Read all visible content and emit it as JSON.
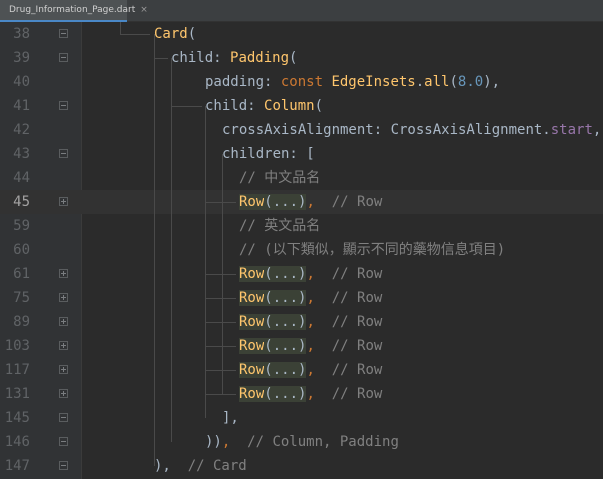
{
  "tab": {
    "filename": "Drug_Information_Page.dart",
    "close": "×"
  },
  "lines": [
    {
      "num": "38",
      "fold": "minus",
      "indent": 154,
      "tokens": [
        [
          "cls",
          "Card"
        ],
        [
          "plain",
          "("
        ]
      ]
    },
    {
      "num": "39",
      "fold": "minus",
      "indent": 171,
      "tokens": [
        [
          "plain",
          "child: "
        ],
        [
          "cls",
          "Padding"
        ],
        [
          "plain",
          "("
        ]
      ]
    },
    {
      "num": "40",
      "fold": "none",
      "indent": 205,
      "tokens": [
        [
          "plain",
          "padding: "
        ],
        [
          "kw",
          "const "
        ],
        [
          "cls",
          "EdgeInsets"
        ],
        [
          "plain",
          "."
        ],
        [
          "fn",
          "all"
        ],
        [
          "plain",
          "("
        ],
        [
          "num",
          "8.0"
        ],
        [
          "plain",
          "),"
        ]
      ]
    },
    {
      "num": "41",
      "fold": "minus",
      "indent": 205,
      "tokens": [
        [
          "plain",
          "child: "
        ],
        [
          "cls",
          "Column"
        ],
        [
          "plain",
          "("
        ]
      ]
    },
    {
      "num": "42",
      "fold": "none",
      "indent": 222,
      "tokens": [
        [
          "plain",
          "crossAxisAlignment: "
        ],
        [
          "plain",
          "CrossAxisAlignment."
        ],
        [
          "prop",
          "start"
        ],
        [
          "plain",
          ","
        ]
      ]
    },
    {
      "num": "43",
      "fold": "minus",
      "indent": 222,
      "tokens": [
        [
          "plain",
          "children: ["
        ]
      ]
    },
    {
      "num": "44",
      "fold": "none",
      "indent": 239,
      "tokens": [
        [
          "cmt",
          "// 中文品名"
        ]
      ]
    },
    {
      "num": "45",
      "fold": "plus",
      "indent": 239,
      "current": true,
      "tokens": [
        [
          "rowname",
          "Row"
        ],
        [
          "folded",
          "(...)"
        ],
        [
          "kw",
          ","
        ],
        [
          "cmt",
          "  // Row"
        ]
      ]
    },
    {
      "num": "59",
      "fold": "none",
      "indent": 239,
      "tokens": [
        [
          "cmt",
          "// 英文品名"
        ]
      ]
    },
    {
      "num": "60",
      "fold": "none",
      "indent": 239,
      "tokens": [
        [
          "cmt",
          "// (以下類似，顯示不同的藥物信息項目)"
        ]
      ]
    },
    {
      "num": "61",
      "fold": "plus",
      "indent": 239,
      "tokens": [
        [
          "rowname",
          "Row"
        ],
        [
          "folded",
          "(...)"
        ],
        [
          "kw",
          ","
        ],
        [
          "cmt",
          "  // Row"
        ]
      ]
    },
    {
      "num": "75",
      "fold": "plus",
      "indent": 239,
      "tokens": [
        [
          "rowname",
          "Row"
        ],
        [
          "folded",
          "(...)"
        ],
        [
          "kw",
          ","
        ],
        [
          "cmt",
          "  // Row"
        ]
      ]
    },
    {
      "num": "89",
      "fold": "plus",
      "indent": 239,
      "tokens": [
        [
          "rowname",
          "Row"
        ],
        [
          "folded",
          "(...)"
        ],
        [
          "kw",
          ","
        ],
        [
          "cmt",
          "  // Row"
        ]
      ]
    },
    {
      "num": "103",
      "fold": "plus",
      "indent": 239,
      "tokens": [
        [
          "rowname",
          "Row"
        ],
        [
          "folded",
          "(...)"
        ],
        [
          "kw",
          ","
        ],
        [
          "cmt",
          "  // Row"
        ]
      ]
    },
    {
      "num": "117",
      "fold": "plus",
      "indent": 239,
      "tokens": [
        [
          "rowname",
          "Row"
        ],
        [
          "folded",
          "(...)"
        ],
        [
          "kw",
          ","
        ],
        [
          "cmt",
          "  // Row"
        ]
      ]
    },
    {
      "num": "131",
      "fold": "plus",
      "indent": 239,
      "tokens": [
        [
          "rowname",
          "Row"
        ],
        [
          "folded",
          "(...)"
        ],
        [
          "kw",
          ","
        ],
        [
          "cmt",
          "  // Row"
        ]
      ]
    },
    {
      "num": "145",
      "fold": "minus",
      "indent": 222,
      "tokens": [
        [
          "plain",
          "],"
        ]
      ]
    },
    {
      "num": "146",
      "fold": "minus",
      "indent": 205,
      "tokens": [
        [
          "plain",
          "))"
        ],
        [
          "kw",
          ","
        ],
        [
          "cmt",
          "  // Column, Padding"
        ]
      ]
    },
    {
      "num": "147",
      "fold": "minus",
      "indent": 154,
      "tokens": [
        [
          "plain",
          "),"
        ],
        [
          "cmt",
          "  // Card"
        ]
      ]
    }
  ]
}
